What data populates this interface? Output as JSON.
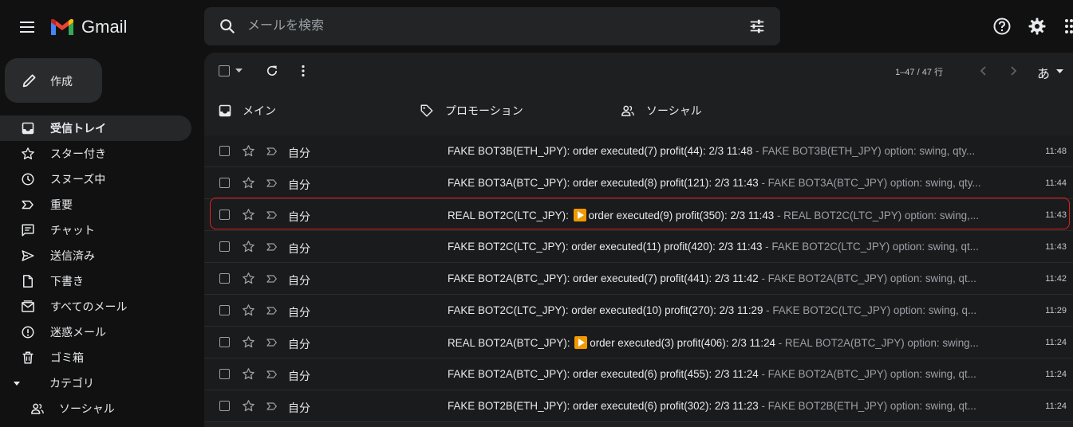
{
  "app": {
    "title": "Gmail",
    "brand_colors": [
      "#4285f4",
      "#ea4335",
      "#fbbc04",
      "#34a853"
    ]
  },
  "search": {
    "placeholder": "メールを検索"
  },
  "compose": {
    "label": "作成"
  },
  "sidebar": {
    "items": [
      {
        "label": "受信トレイ",
        "icon": "inbox-icon",
        "active": true
      },
      {
        "label": "スター付き",
        "icon": "star-icon"
      },
      {
        "label": "スヌーズ中",
        "icon": "clock-icon"
      },
      {
        "label": "重要",
        "icon": "important-icon"
      },
      {
        "label": "チャット",
        "icon": "chat-icon"
      },
      {
        "label": "送信済み",
        "icon": "send-icon"
      },
      {
        "label": "下書き",
        "icon": "draft-icon"
      },
      {
        "label": "すべてのメール",
        "icon": "all-mail-icon"
      },
      {
        "label": "迷惑メール",
        "icon": "spam-icon"
      },
      {
        "label": "ゴミ箱",
        "icon": "trash-icon"
      },
      {
        "label": "カテゴリ",
        "icon": "caret-down-icon"
      },
      {
        "label": "ソーシャル",
        "icon": "people-icon"
      }
    ]
  },
  "toolbar": {
    "pager": "1–47 / 47 行",
    "input_tool": "あ"
  },
  "tabs": [
    {
      "label": "メイン",
      "icon": "inbox-icon"
    },
    {
      "label": "プロモーション",
      "icon": "tag-icon"
    },
    {
      "label": "ソーシャル",
      "icon": "people-icon"
    }
  ],
  "emails": [
    {
      "sender": "自分",
      "subject": "FAKE BOT3B(ETH_JPY): order executed(7) profit(44): 2/3 11:48",
      "snippet": " - FAKE BOT3B(ETH_JPY) option: swing, qty...",
      "time": "11:48",
      "play": false
    },
    {
      "sender": "自分",
      "subject": "FAKE BOT3A(BTC_JPY): order executed(8) profit(121): 2/3 11:43",
      "snippet": " - FAKE BOT3A(BTC_JPY) option: swing, qty...",
      "time": "11:44",
      "play": false
    },
    {
      "sender": "自分",
      "subject_pre": "REAL BOT2C(LTC_JPY): ",
      "subject": "order executed(9) profit(350): 2/3 11:43",
      "snippet": " - REAL BOT2C(LTC_JPY) option: swing,...",
      "time": "11:43",
      "play": true
    },
    {
      "sender": "自分",
      "subject": "FAKE BOT2C(LTC_JPY): order executed(11) profit(420): 2/3 11:43",
      "snippet": " - FAKE BOT2C(LTC_JPY) option: swing, qt...",
      "time": "11:43",
      "play": false
    },
    {
      "sender": "自分",
      "subject": "FAKE BOT2A(BTC_JPY): order executed(7) profit(441): 2/3 11:42",
      "snippet": " - FAKE BOT2A(BTC_JPY) option: swing, qt...",
      "time": "11:42",
      "play": false
    },
    {
      "sender": "自分",
      "subject": "FAKE BOT2C(LTC_JPY): order executed(10) profit(270): 2/3 11:29",
      "snippet": " - FAKE BOT2C(LTC_JPY) option: swing, q...",
      "time": "11:29",
      "play": false
    },
    {
      "sender": "自分",
      "subject_pre": "REAL BOT2A(BTC_JPY): ",
      "subject": "order executed(3) profit(406): 2/3 11:24",
      "snippet": " - REAL BOT2A(BTC_JPY) option: swing...",
      "time": "11:24",
      "play": true
    },
    {
      "sender": "自分",
      "subject": "FAKE BOT2A(BTC_JPY): order executed(6) profit(455): 2/3 11:24",
      "snippet": " - FAKE BOT2A(BTC_JPY) option: swing, qt...",
      "time": "11:24",
      "play": false
    },
    {
      "sender": "自分",
      "subject": "FAKE BOT2B(ETH_JPY): order executed(6) profit(302): 2/3 11:23",
      "snippet": " - FAKE BOT2B(ETH_JPY) option: swing, qt...",
      "time": "11:24",
      "play": false
    }
  ],
  "colors": {
    "highlight": "#e0201b",
    "play_badge": "#f29900"
  }
}
